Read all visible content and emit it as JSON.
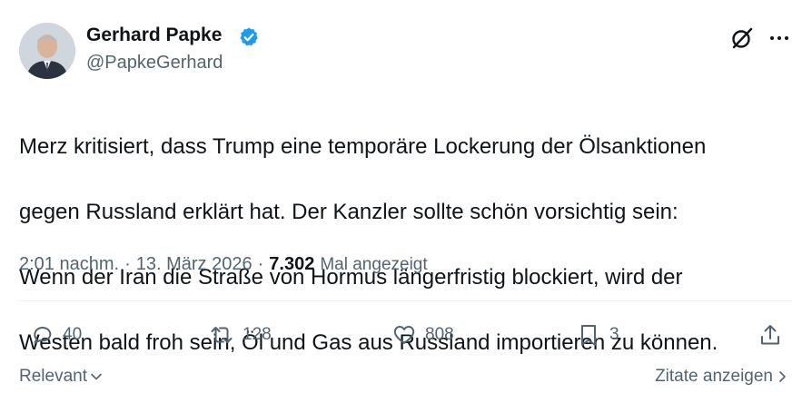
{
  "author": {
    "name": "Gerhard Papke",
    "handle": "@PapkeGerhard",
    "verified": true,
    "verified_color": "#1d9bf0"
  },
  "tweet": {
    "lines": [
      "Merz kritisiert, dass Trump eine temporäre Lockerung der Ölsanktionen",
      "gegen Russland erklärt hat. Der Kanzler sollte schön vorsichtig sein:",
      "Wenn der Iran die Straße von Hormus längerfristig blockiert, wird der",
      "Westen bald froh sein, Öl und Gas aus Russland importieren zu können."
    ],
    "time": "2:01 nachm.",
    "separator": "·",
    "date": "13. März 2026",
    "views_count": "7.302",
    "views_label": "Mal angezeigt"
  },
  "actions": {
    "replies": "40",
    "reposts": "128",
    "likes": "808",
    "bookmarks": "3"
  },
  "footer": {
    "sort_label": "Relevant",
    "quotes_label": "Zitate anzeigen"
  },
  "icons": {
    "header": [
      "grok-icon",
      "more-icon"
    ],
    "actions": [
      "reply-icon",
      "repost-icon",
      "like-icon",
      "bookmark-icon",
      "share-icon"
    ]
  },
  "colors": {
    "text_primary": "#0f1419",
    "text_secondary": "#536471",
    "divider": "#eff3f4"
  }
}
